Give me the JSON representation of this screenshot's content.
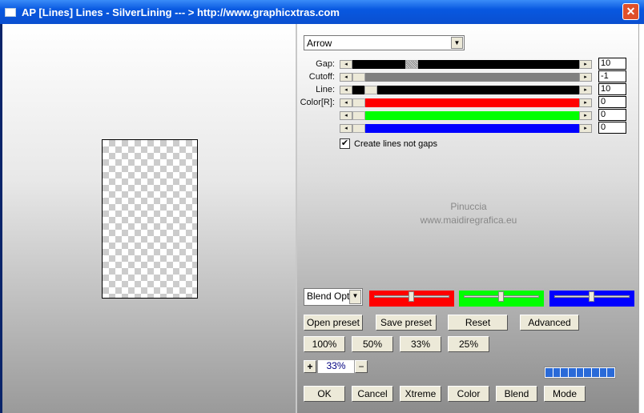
{
  "window": {
    "title": "AP [Lines]  Lines - SilverLining     --- > http://www.graphicxtras.com",
    "close": "✕"
  },
  "preset": {
    "value": "Arrow"
  },
  "sliders": [
    {
      "label": "Gap:",
      "value": "10",
      "color": "#000000",
      "position": 0.08
    },
    {
      "label": "Cutoff:",
      "value": "-1",
      "color": "#808080",
      "position": 0.0
    },
    {
      "label": "Line:",
      "value": "10",
      "color": "#000000",
      "position": 0.02
    },
    {
      "label": "Color[R]:",
      "value": "0",
      "color": "#ff0000",
      "position": 0.0
    },
    {
      "label": "",
      "value": "0",
      "color": "#00ff00",
      "position": 0.0
    },
    {
      "label": "",
      "value": "0",
      "color": "#0000ff",
      "position": 0.0
    }
  ],
  "checkbox": {
    "label": "Create lines not gaps",
    "checked": true
  },
  "watermark": {
    "line1": "Pinuccia",
    "line2": "www.maidiregrafica.eu"
  },
  "blend": {
    "value": "Blend Optio",
    "swatches": [
      {
        "color": "#ff0000",
        "level": 0.5
      },
      {
        "color": "#00ff00",
        "level": 0.5
      },
      {
        "color": "#0000ff",
        "level": 0.5
      }
    ]
  },
  "buttons": {
    "open_preset": "Open preset",
    "save_preset": "Save preset",
    "reset": "Reset",
    "advanced": "Advanced",
    "z100": "100%",
    "z50": "50%",
    "z33": "33%",
    "z25": "25%",
    "ok": "OK",
    "cancel": "Cancel",
    "xtreme": "Xtreme",
    "color": "Color",
    "blend": "Blend",
    "mode": "Mode"
  },
  "zoom": {
    "plus": "+",
    "value": "33%",
    "minus": "−"
  }
}
